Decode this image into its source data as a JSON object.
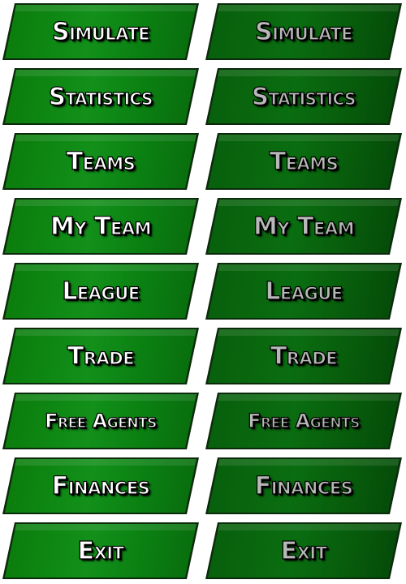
{
  "buttons": [
    {
      "label": "Simulate"
    },
    {
      "label": "Statistics"
    },
    {
      "label": "Teams"
    },
    {
      "label": "My Team"
    },
    {
      "label": "League"
    },
    {
      "label": "Trade"
    },
    {
      "label": "Free Agents"
    },
    {
      "label": "Finances"
    },
    {
      "label": "Exit"
    }
  ],
  "states": [
    "normal",
    "pressed"
  ],
  "colors": {
    "normal_fill": "#12901a",
    "pressed_fill": "#0a6d10",
    "normal_text": "#ffffff",
    "pressed_text": "#b8b8b8",
    "outline": "#000000"
  }
}
